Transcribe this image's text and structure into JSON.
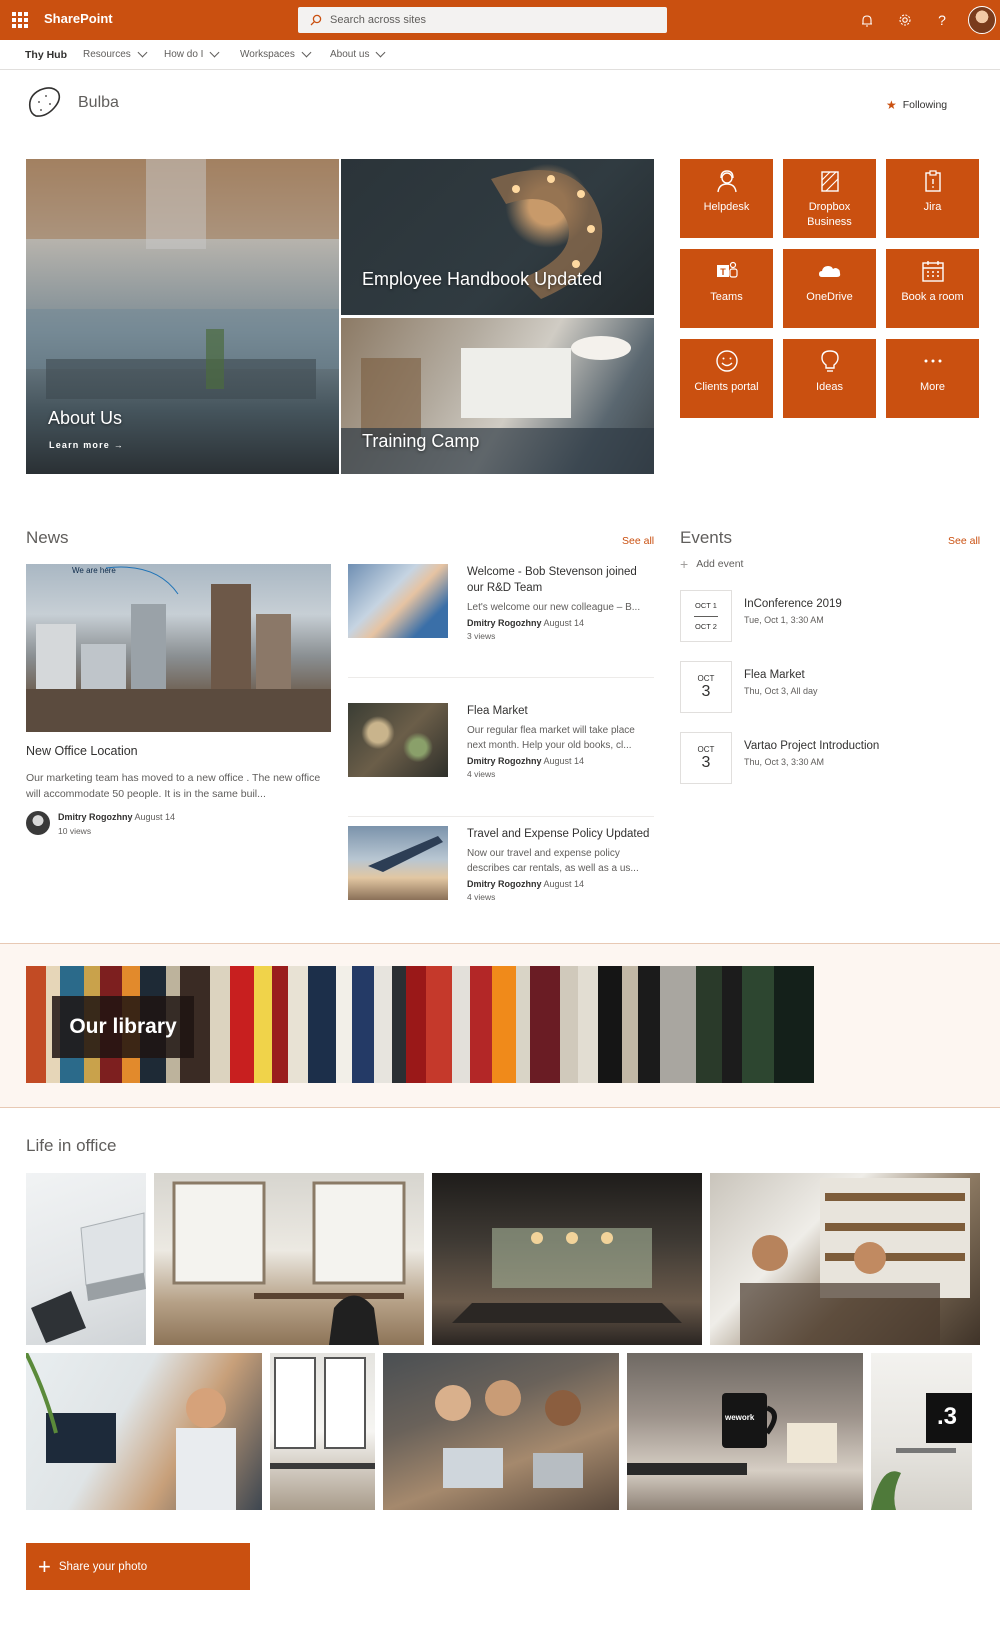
{
  "suitebar": {
    "app_name": "SharePoint",
    "search_placeholder": "Search across sites",
    "brand_color": "#ca5010",
    "icons": [
      "waffle-icon",
      "bell-icon",
      "gear-icon",
      "help-icon"
    ]
  },
  "topnav": {
    "items": [
      {
        "label": "Thy Hub"
      },
      {
        "label": "Resources"
      },
      {
        "label": "How do I"
      },
      {
        "label": "Workspaces"
      },
      {
        "label": "About us"
      }
    ]
  },
  "site": {
    "name": "Bulba",
    "follow_label": "Following"
  },
  "hero": {
    "tiles": [
      {
        "title": "About Us",
        "link": "Learn more"
      },
      {
        "title": "Employee Handbook Updated"
      },
      {
        "title": "Training Camp"
      }
    ]
  },
  "quick_links": [
    {
      "label": "Helpdesk",
      "icon": "helpdesk-icon"
    },
    {
      "label": "Dropbox Business",
      "icon": "dropbox-icon"
    },
    {
      "label": "Jira",
      "icon": "clipboard-icon"
    },
    {
      "label": "Teams",
      "icon": "teams-icon"
    },
    {
      "label": "OneDrive",
      "icon": "cloud-icon"
    },
    {
      "label": "Book a room",
      "icon": "calendar-icon"
    },
    {
      "label": "Clients portal",
      "icon": "smiley-icon"
    },
    {
      "label": "Ideas",
      "icon": "lightbulb-icon"
    },
    {
      "label": "More",
      "icon": "more-icon"
    }
  ],
  "news": {
    "title": "News",
    "see_all": "See all",
    "featured": {
      "image_caption": "We are here",
      "title": "New Office Location",
      "description": "Our marketing team has moved to a new office . The new office will accommodate 50 people. It is in the same buil...",
      "author": "Dmitry Rogozhny",
      "date": "August 14",
      "views": "10 views"
    },
    "items": [
      {
        "title": "Welcome - Bob Stevenson joined our R&D Team",
        "description": "Let's welcome our new colleague – B...",
        "author": "Dmitry Rogozhny",
        "date": "August 14",
        "views": "3 views"
      },
      {
        "title": "Flea Market",
        "description": "Our regular flea market will take place next month. Help your old books, cl...",
        "author": "Dmitry Rogozhny",
        "date": "August 14",
        "views": "4 views"
      },
      {
        "title": "Travel and Expense Policy Updated",
        "description": "Now our travel and expense policy describes car rentals, as well as a us...",
        "author": "Dmitry Rogozhny",
        "date": "August 14",
        "views": "4 views"
      }
    ]
  },
  "events": {
    "title": "Events",
    "see_all": "See all",
    "add_label": "Add event",
    "items": [
      {
        "month_start": "OCT 1",
        "month_end": "OCT 2",
        "title": "InConference 2019",
        "time": "Tue, Oct 1, 3:30 AM"
      },
      {
        "month": "OCT",
        "day": "3",
        "title": "Flea Market",
        "time": "Thu, Oct 3, All day"
      },
      {
        "month": "OCT",
        "day": "3",
        "title": "Vartao Project Introduction",
        "time": "Thu, Oct 3, 3:30 AM"
      }
    ]
  },
  "library": {
    "title": "Our library"
  },
  "life": {
    "title": "Life in office",
    "share_label": "Share your photo",
    "badge": ".3",
    "mug_text": "wework"
  }
}
